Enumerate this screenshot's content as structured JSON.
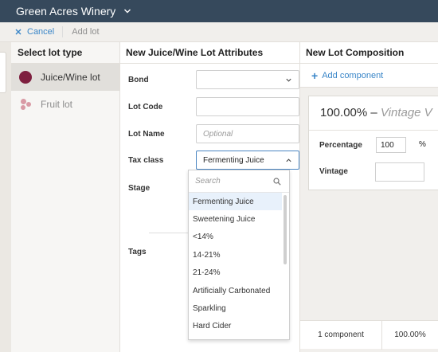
{
  "app": {
    "title": "Green Acres Winery",
    "accent": "#3a86c8",
    "topbar_color": "#36495c"
  },
  "actions": {
    "cancel_label": "Cancel",
    "add_lot_label": "Add lot"
  },
  "lot_type": {
    "heading": "Select lot type",
    "items": [
      {
        "label": "Juice/Wine lot",
        "icon": "juice-wine-dot-icon",
        "selected": true,
        "color": "#7e1f3f"
      },
      {
        "label": "Fruit lot",
        "icon": "fruit-cluster-icon",
        "selected": false,
        "color": "#d99aa5"
      }
    ]
  },
  "attributes": {
    "heading": "New Juice/Wine Lot Attributes",
    "fields": {
      "bond": {
        "label": "Bond",
        "value": ""
      },
      "lot_code": {
        "label": "Lot Code",
        "value": ""
      },
      "lot_name": {
        "label": "Lot Name",
        "placeholder": "Optional"
      },
      "tax_class": {
        "label": "Tax class",
        "value": "Fermenting Juice"
      },
      "stage": {
        "label": "Stage"
      },
      "tags": {
        "label": "Tags"
      }
    },
    "tax_dropdown": {
      "search_placeholder": "Search",
      "options": [
        "Fermenting Juice",
        "Sweetening Juice",
        "<14%",
        "14-21%",
        "21-24%",
        "Artificially Carbonated",
        "Sparkling",
        "Hard Cider"
      ],
      "highlighted": "Fermenting Juice"
    }
  },
  "composition": {
    "heading": "New Lot Composition",
    "add_component_label": "Add component",
    "card": {
      "percent_title": "100.00%",
      "dash": "–",
      "vintage_placeholder": "Vintage V",
      "percentage_label": "Percentage",
      "percentage_value": "100",
      "percent_symbol": "%",
      "vintage_label": "Vintage"
    },
    "footer": {
      "count": "1 component",
      "total": "100.00%"
    }
  }
}
